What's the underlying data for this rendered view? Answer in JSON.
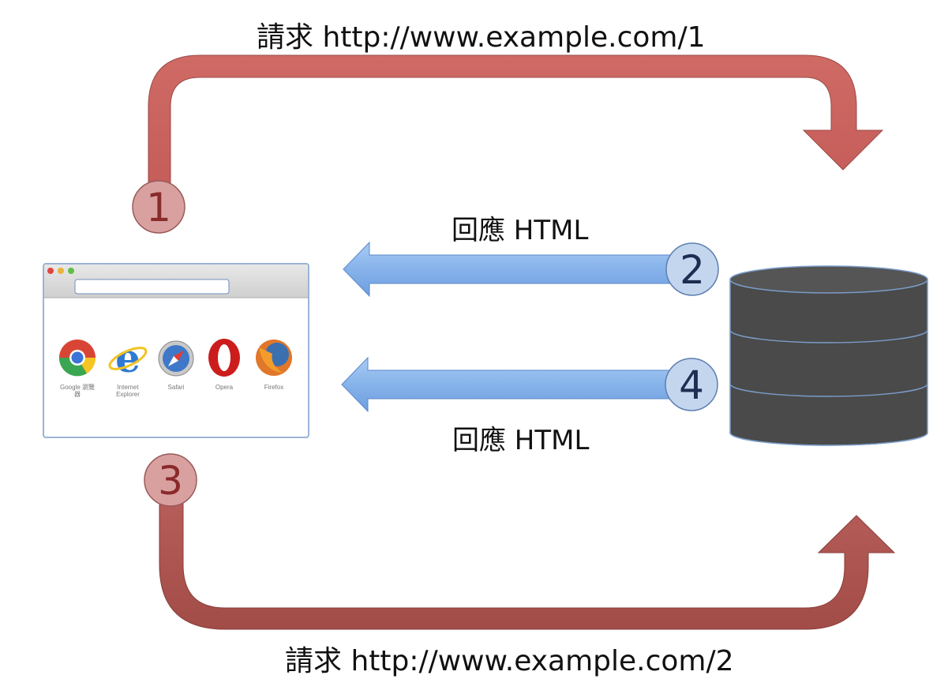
{
  "labels": {
    "request_1": "請求 http://www.example.com/1",
    "response_2": "回應 HTML",
    "response_4": "回應 HTML",
    "request_2": "請求 http://www.example.com/2"
  },
  "steps": [
    "1",
    "2",
    "3",
    "4"
  ],
  "browser": {
    "icons": [
      {
        "name": "chrome-icon",
        "caption_lines": [
          "Google 瀏覽",
          "器"
        ]
      },
      {
        "name": "internet-explorer-icon",
        "caption_lines": [
          "Internet",
          "Explorer"
        ]
      },
      {
        "name": "safari-icon",
        "caption_lines": [
          "Safari"
        ]
      },
      {
        "name": "opera-icon",
        "caption_lines": [
          "Opera"
        ]
      },
      {
        "name": "firefox-icon",
        "caption_lines": [
          "Firefox"
        ]
      }
    ]
  },
  "colors": {
    "request_arrow": "#c9605c",
    "request_arrow_dark": "#a8504c",
    "response_arrow": "#86b3ea",
    "step_red_fill": "#d9a0a0",
    "step_red_text": "#8a2a2a",
    "step_blue_fill": "#c3d6ee",
    "step_blue_text": "#1e2e52",
    "database": "#4a4a4a"
  }
}
